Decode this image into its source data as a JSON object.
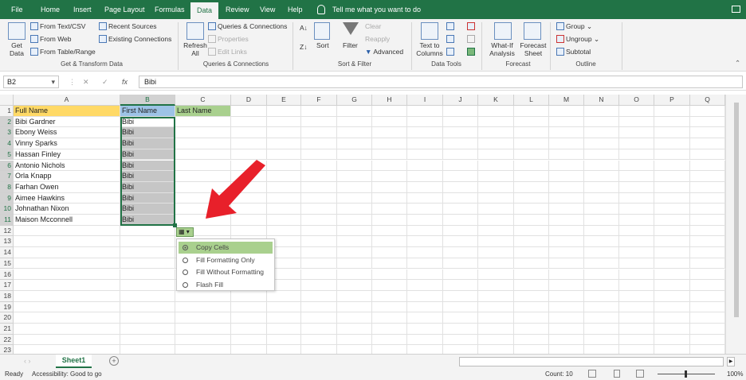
{
  "tabs": [
    "File",
    "Home",
    "Insert",
    "Page Layout",
    "Formulas",
    "Data",
    "Review",
    "View",
    "Help"
  ],
  "active_tab": "Data",
  "tell_me": "Tell me what you want to do",
  "ribbon": {
    "get_data": "Get Data",
    "from_text": "From Text/CSV",
    "from_web": "From Web",
    "from_table": "From Table/Range",
    "recent_sources": "Recent Sources",
    "existing_connections": "Existing Connections",
    "group1": "Get & Transform Data",
    "refresh_all": "Refresh All",
    "queries_connections": "Queries & Connections",
    "properties": "Properties",
    "edit_links": "Edit Links",
    "group2": "Queries & Connections",
    "sort": "Sort",
    "filter": "Filter",
    "clear": "Clear",
    "reapply": "Reapply",
    "advanced": "Advanced",
    "group3": "Sort & Filter",
    "text_to_columns": "Text to Columns",
    "group4": "Data Tools",
    "what_if": "What-If Analysis",
    "forecast_sheet": "Forecast Sheet",
    "group5": "Forecast",
    "group": "Group",
    "ungroup": "Ungroup",
    "subtotal": "Subtotal",
    "group6": "Outline"
  },
  "formula_bar": {
    "name_box": "B2",
    "value": "Bibi",
    "fx": "fx"
  },
  "columns": [
    "A",
    "B",
    "C",
    "D",
    "E",
    "F",
    "G",
    "H",
    "I",
    "J",
    "K",
    "L",
    "M",
    "N",
    "O",
    "P",
    "Q"
  ],
  "rows": [
    [
      "Full Name",
      "First Name",
      "Last Name"
    ],
    [
      "Bibi Gardner",
      "Bibi"
    ],
    [
      "Ebony Weiss",
      "Bibi"
    ],
    [
      "Vinny Sparks",
      "Bibi"
    ],
    [
      "Hassan Finley",
      "Bibi"
    ],
    [
      "Antonio Nichols",
      "Bibi"
    ],
    [
      "Orla Knapp",
      "Bibi"
    ],
    [
      "Farhan Owen",
      "Bibi"
    ],
    [
      "Aimee Hawkins",
      "Bibi"
    ],
    [
      "Johnathan Nixon",
      "Bibi"
    ],
    [
      "Maison Mcconnell",
      "Bibi"
    ]
  ],
  "row_count": 23,
  "autofill_menu": [
    "Copy Cells",
    "Fill Formatting Only",
    "Fill Without Formatting",
    "Flash Fill"
  ],
  "autofill_selected": 0,
  "sheet_tab": "Sheet1",
  "status": {
    "ready": "Ready",
    "accessibility": "Accessibility: Good to go",
    "count": "Count: 10",
    "zoom": "100%"
  },
  "colors": {
    "green": "#217346",
    "header_yellow": "#ffd966",
    "header_blue": "#9dc3e6",
    "header_green": "#a9d08e",
    "arrow": "#e8202a"
  }
}
